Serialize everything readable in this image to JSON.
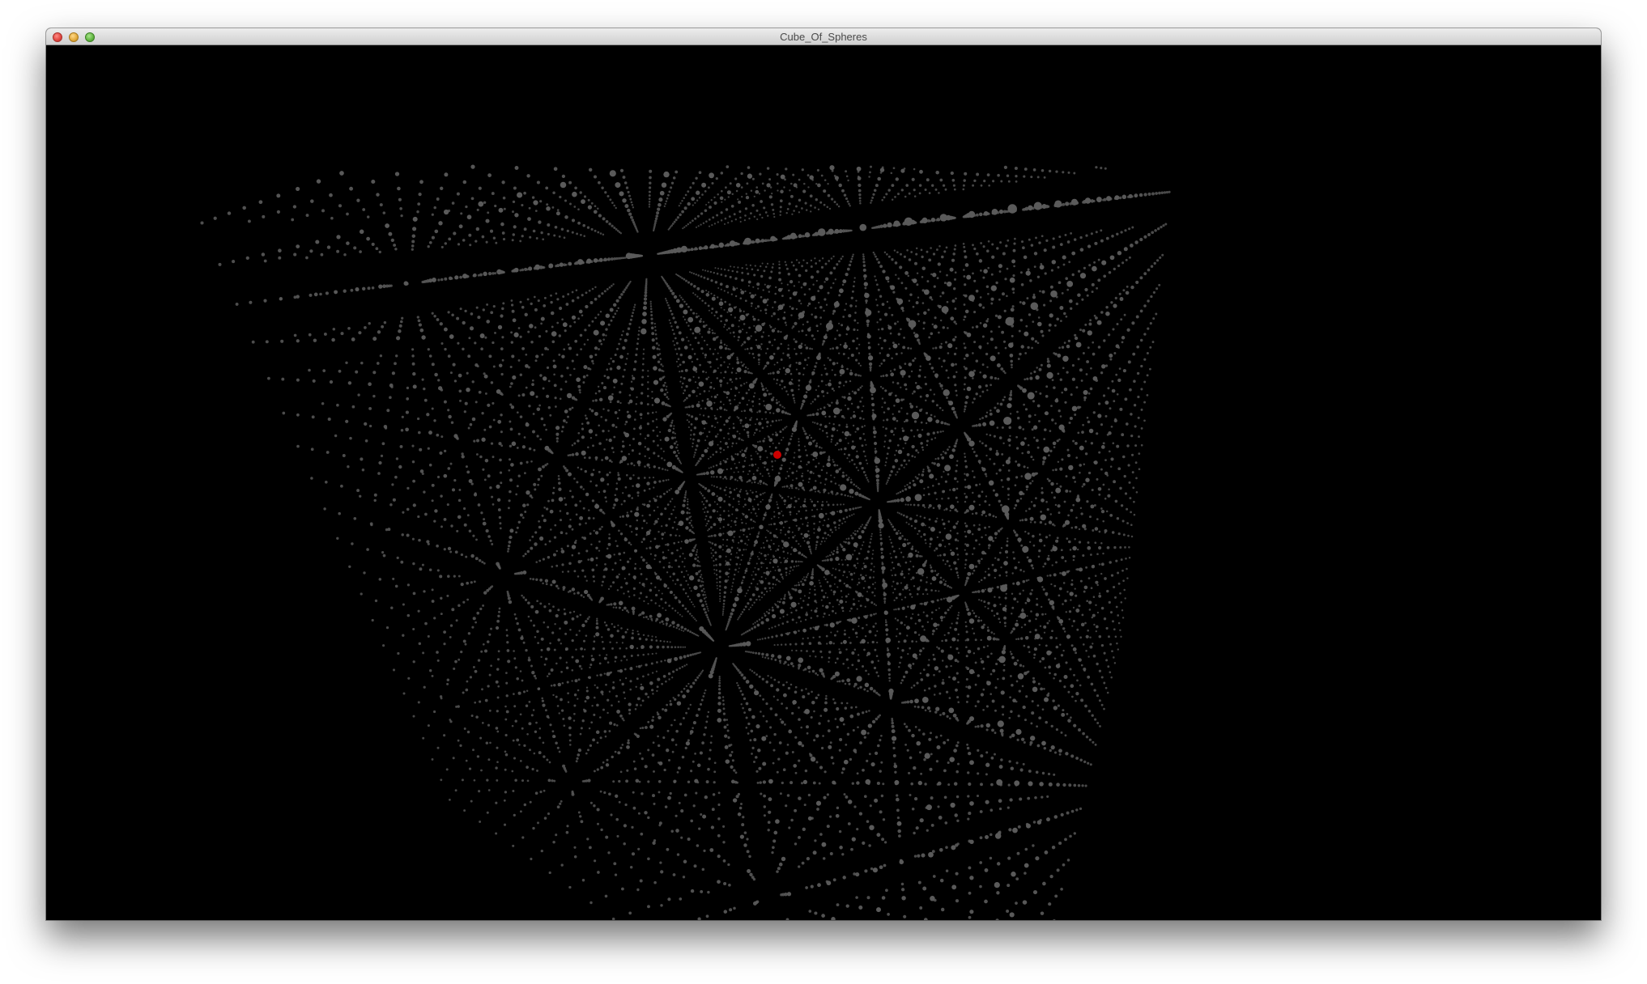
{
  "window": {
    "title": "Cube_Of_Spheres"
  },
  "scene": {
    "background": "#000000",
    "sphere_color": "#5a5a5a",
    "highlight_color": "#cc0000",
    "grid_size": 21
  }
}
